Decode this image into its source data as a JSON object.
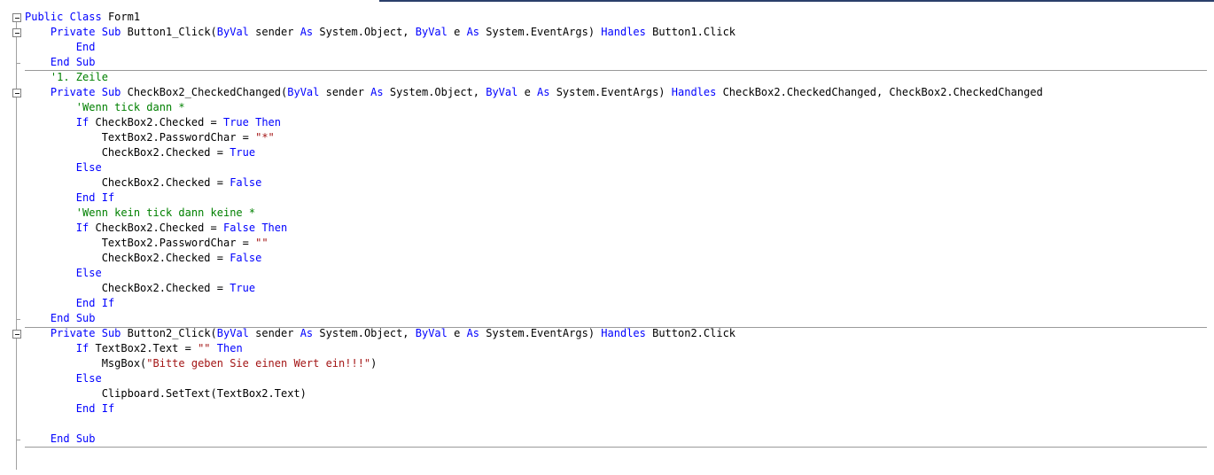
{
  "colors": {
    "keyword": "#0000ff",
    "comment": "#008000",
    "string": "#a31515",
    "plain": "#000000",
    "separator": "#9a9a9a",
    "top_accent": "#2b3f6b"
  },
  "icons": {
    "collapse": "collapse-minus-box-icon"
  },
  "code_lines": [
    [
      {
        "t": "Public",
        "c": "kw"
      },
      {
        "t": " "
      },
      {
        "t": "Class",
        "c": "kw"
      },
      {
        "t": " Form1"
      }
    ],
    [
      {
        "t": "    "
      },
      {
        "t": "Private",
        "c": "kw"
      },
      {
        "t": " "
      },
      {
        "t": "Sub",
        "c": "kw"
      },
      {
        "t": " Button1_Click("
      },
      {
        "t": "ByVal",
        "c": "kw"
      },
      {
        "t": " sender "
      },
      {
        "t": "As",
        "c": "kw"
      },
      {
        "t": " System.Object, "
      },
      {
        "t": "ByVal",
        "c": "kw"
      },
      {
        "t": " e "
      },
      {
        "t": "As",
        "c": "kw"
      },
      {
        "t": " System.EventArgs) "
      },
      {
        "t": "Handles",
        "c": "kw"
      },
      {
        "t": " Button1.Click"
      }
    ],
    [
      {
        "t": "        "
      },
      {
        "t": "End",
        "c": "kw"
      }
    ],
    [
      {
        "t": "    "
      },
      {
        "t": "End",
        "c": "kw"
      },
      {
        "t": " "
      },
      {
        "t": "Sub",
        "c": "kw"
      }
    ],
    [
      {
        "t": "    "
      },
      {
        "t": "'1. Zeile",
        "c": "cm"
      }
    ],
    [
      {
        "t": "    "
      },
      {
        "t": "Private",
        "c": "kw"
      },
      {
        "t": " "
      },
      {
        "t": "Sub",
        "c": "kw"
      },
      {
        "t": " CheckBox2_CheckedChanged("
      },
      {
        "t": "ByVal",
        "c": "kw"
      },
      {
        "t": " sender "
      },
      {
        "t": "As",
        "c": "kw"
      },
      {
        "t": " System.Object, "
      },
      {
        "t": "ByVal",
        "c": "kw"
      },
      {
        "t": " e "
      },
      {
        "t": "As",
        "c": "kw"
      },
      {
        "t": " System.EventArgs) "
      },
      {
        "t": "Handles",
        "c": "kw"
      },
      {
        "t": " CheckBox2.CheckedChanged, CheckBox2.CheckedChanged"
      }
    ],
    [
      {
        "t": "        "
      },
      {
        "t": "'Wenn tick dann *",
        "c": "cm"
      }
    ],
    [
      {
        "t": "        "
      },
      {
        "t": "If",
        "c": "kw"
      },
      {
        "t": " CheckBox2.Checked = "
      },
      {
        "t": "True",
        "c": "kw"
      },
      {
        "t": " "
      },
      {
        "t": "Then",
        "c": "kw"
      }
    ],
    [
      {
        "t": "            TextBox2.PasswordChar = "
      },
      {
        "t": "\"*\"",
        "c": "st"
      }
    ],
    [
      {
        "t": "            CheckBox2.Checked = "
      },
      {
        "t": "True",
        "c": "kw"
      }
    ],
    [
      {
        "t": "        "
      },
      {
        "t": "Else",
        "c": "kw"
      }
    ],
    [
      {
        "t": "            CheckBox2.Checked = "
      },
      {
        "t": "False",
        "c": "kw"
      }
    ],
    [
      {
        "t": "        "
      },
      {
        "t": "End",
        "c": "kw"
      },
      {
        "t": " "
      },
      {
        "t": "If",
        "c": "kw"
      }
    ],
    [
      {
        "t": "        "
      },
      {
        "t": "'Wenn kein tick dann keine *",
        "c": "cm"
      }
    ],
    [
      {
        "t": "        "
      },
      {
        "t": "If",
        "c": "kw"
      },
      {
        "t": " CheckBox2.Checked = "
      },
      {
        "t": "False",
        "c": "kw"
      },
      {
        "t": " "
      },
      {
        "t": "Then",
        "c": "kw"
      }
    ],
    [
      {
        "t": "            TextBox2.PasswordChar = "
      },
      {
        "t": "\"\"",
        "c": "st"
      }
    ],
    [
      {
        "t": "            CheckBox2.Checked = "
      },
      {
        "t": "False",
        "c": "kw"
      }
    ],
    [
      {
        "t": "        "
      },
      {
        "t": "Else",
        "c": "kw"
      }
    ],
    [
      {
        "t": "            CheckBox2.Checked = "
      },
      {
        "t": "True",
        "c": "kw"
      }
    ],
    [
      {
        "t": "        "
      },
      {
        "t": "End",
        "c": "kw"
      },
      {
        "t": " "
      },
      {
        "t": "If",
        "c": "kw"
      }
    ],
    [
      {
        "t": "    "
      },
      {
        "t": "End",
        "c": "kw"
      },
      {
        "t": " "
      },
      {
        "t": "Sub",
        "c": "kw"
      }
    ],
    [
      {
        "t": "    "
      },
      {
        "t": "Private",
        "c": "kw"
      },
      {
        "t": " "
      },
      {
        "t": "Sub",
        "c": "kw"
      },
      {
        "t": " Button2_Click("
      },
      {
        "t": "ByVal",
        "c": "kw"
      },
      {
        "t": " sender "
      },
      {
        "t": "As",
        "c": "kw"
      },
      {
        "t": " System.Object, "
      },
      {
        "t": "ByVal",
        "c": "kw"
      },
      {
        "t": " e "
      },
      {
        "t": "As",
        "c": "kw"
      },
      {
        "t": " System.EventArgs) "
      },
      {
        "t": "Handles",
        "c": "kw"
      },
      {
        "t": " Button2.Click"
      }
    ],
    [
      {
        "t": "        "
      },
      {
        "t": "If",
        "c": "kw"
      },
      {
        "t": " TextBox2.Text = "
      },
      {
        "t": "\"\"",
        "c": "st"
      },
      {
        "t": " "
      },
      {
        "t": "Then",
        "c": "kw"
      }
    ],
    [
      {
        "t": "            MsgBox("
      },
      {
        "t": "\"Bitte geben Sie einen Wert ein!!!\"",
        "c": "st"
      },
      {
        "t": ")"
      }
    ],
    [
      {
        "t": "        "
      },
      {
        "t": "Else",
        "c": "kw"
      }
    ],
    [
      {
        "t": "            Clipboard.SetText(TextBox2.Text)"
      }
    ],
    [
      {
        "t": "        "
      },
      {
        "t": "End",
        "c": "kw"
      },
      {
        "t": " "
      },
      {
        "t": "If",
        "c": "kw"
      }
    ],
    [
      {
        "t": ""
      }
    ],
    [
      {
        "t": "    "
      },
      {
        "t": "End",
        "c": "kw"
      },
      {
        "t": " "
      },
      {
        "t": "Sub",
        "c": "kw"
      }
    ]
  ]
}
